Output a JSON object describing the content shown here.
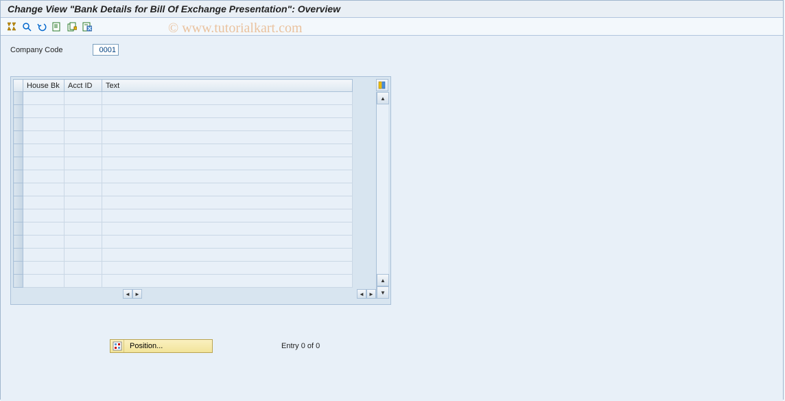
{
  "title": "Change View \"Bank Details for Bill Of Exchange Presentation\": Overview",
  "toolbar_icons": [
    "change-display",
    "details",
    "undo",
    "new-entries",
    "copy",
    "delete"
  ],
  "watermark": "© www.tutorialkart.com",
  "company_code": {
    "label": "Company Code",
    "value": "0001"
  },
  "table": {
    "columns": [
      "House Bk",
      "Acct ID",
      "Text"
    ],
    "rows": [
      [
        "",
        "",
        ""
      ],
      [
        "",
        "",
        ""
      ],
      [
        "",
        "",
        ""
      ],
      [
        "",
        "",
        ""
      ],
      [
        "",
        "",
        ""
      ],
      [
        "",
        "",
        ""
      ],
      [
        "",
        "",
        ""
      ],
      [
        "",
        "",
        ""
      ],
      [
        "",
        "",
        ""
      ],
      [
        "",
        "",
        ""
      ],
      [
        "",
        "",
        ""
      ],
      [
        "",
        "",
        ""
      ],
      [
        "",
        "",
        ""
      ],
      [
        "",
        "",
        ""
      ],
      [
        "",
        "",
        ""
      ]
    ]
  },
  "footer": {
    "position_label": "Position...",
    "entry_text": "Entry 0 of 0"
  }
}
